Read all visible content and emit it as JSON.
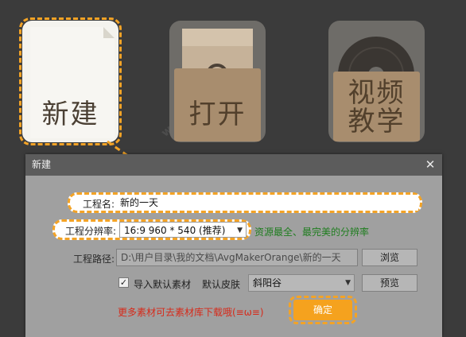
{
  "tiles": {
    "new": {
      "label": "新建",
      "icon": "new-document-icon"
    },
    "open": {
      "label": "打开",
      "icon": "folder-icon"
    },
    "video": {
      "label": "视频\n教学",
      "icon": "disc-icon"
    }
  },
  "dialog": {
    "title": "新建",
    "close_glyph": "✕",
    "project_name_label": "工程名:",
    "project_name_value": "新的一天",
    "resolution_label": "工程分辨率:",
    "resolution_value": "16:9  960  * 540  (推荐)",
    "resolution_hint": "资源最全、最完美的分辨率",
    "path_label": "工程路径:",
    "path_value": "D:\\用户目录\\我的文档\\AvgMakerOrange\\新的一天",
    "browse_button": "浏览",
    "import_default_assets": "导入默认素材",
    "import_default_checked": true,
    "default_skin_label": "默认皮肤",
    "default_skin_value": "斜阳谷",
    "preview_button": "预览",
    "more_assets_link": "更多素材可去素材库下载哦(≡ω≡)",
    "ok_button": "确定"
  },
  "colors": {
    "accent": "#f3a326",
    "hint_green": "#1f7d1f",
    "link_red": "#d62a1a"
  }
}
